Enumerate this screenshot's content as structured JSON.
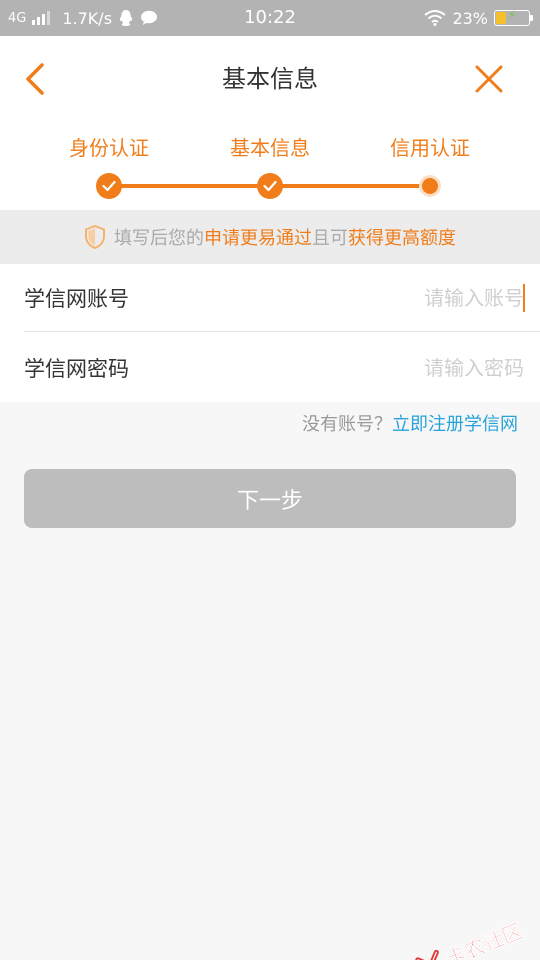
{
  "status_bar": {
    "network": "4G",
    "speed": "1.7K/s",
    "time": "10:22",
    "battery": "23%"
  },
  "header": {
    "title": "基本信息"
  },
  "steps": [
    {
      "label": "身份认证",
      "state": "done"
    },
    {
      "label": "基本信息",
      "state": "done"
    },
    {
      "label": "信用认证",
      "state": "current"
    }
  ],
  "tip": {
    "part1": "填写后您的",
    "highlight1": "申请更易通过",
    "part2": "且可",
    "highlight2": "获得更高额度"
  },
  "form": {
    "account": {
      "label": "学信网账号",
      "placeholder": "请输入账号",
      "value": ""
    },
    "password": {
      "label": "学信网密码",
      "placeholder": "请输入密码",
      "value": ""
    }
  },
  "register": {
    "prefix": "没有账号？",
    "link": "立即注册学信网"
  },
  "next_button": "下一步",
  "watermark": "卡农社区",
  "colors": {
    "accent": "#f07d1a",
    "link": "#27a3d9",
    "button_disabled": "#bdbdbd"
  }
}
